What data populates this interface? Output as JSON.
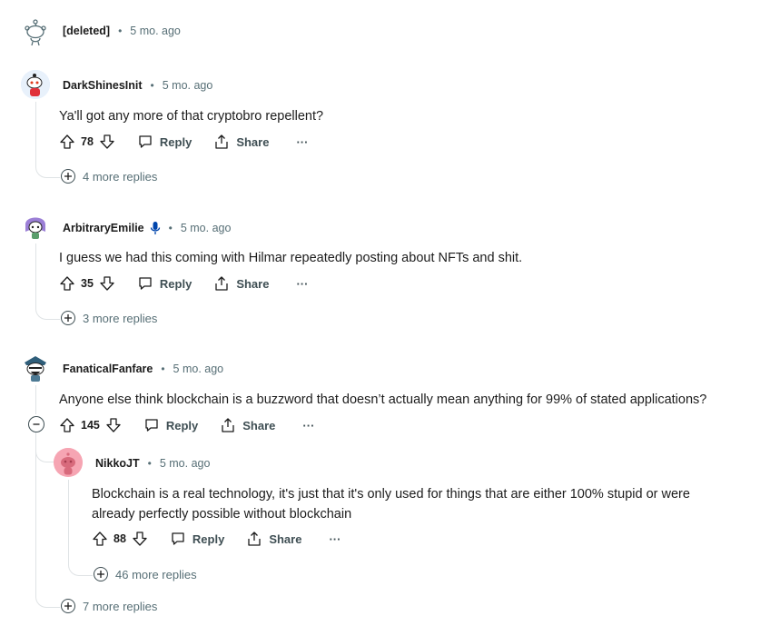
{
  "comments": [
    {
      "username": "[deleted]",
      "time": "5 mo. ago"
    },
    {
      "username": "DarkShinesInit",
      "time": "5 mo. ago",
      "body": "Ya'll got any more of that cryptobro repellent?",
      "votes": "78",
      "reply": "Reply",
      "share": "Share",
      "more_replies": "4 more replies"
    },
    {
      "username": "ArbitraryEmilie",
      "time": "5 mo. ago",
      "body": "I guess we had this coming with Hilmar repeatedly posting about NFTs and shit.",
      "votes": "35",
      "reply": "Reply",
      "share": "Share",
      "more_replies": "3 more replies"
    },
    {
      "username": "FanaticalFanfare",
      "time": "5 mo. ago",
      "body": "Anyone else think blockchain is a buzzword that doesn’t actually mean anything for 99% of stated applications?",
      "votes": "145",
      "reply": "Reply",
      "share": "Share",
      "more_replies": "7 more replies"
    },
    {
      "username": "NikkoJT",
      "time": "5 mo. ago",
      "body_lines": [
        "Blockchain is a real technology, it's just that it's only used for things that are either 100% stupid or were",
        "already perfectly possible without blockchain"
      ],
      "votes": "88",
      "reply": "Reply",
      "share": "Share",
      "more_replies": "46 more replies"
    }
  ],
  "separator": "•",
  "overflow_glyph": "···",
  "colors": {
    "text": "#1c1c1c",
    "meta": "#576f76",
    "thread_line": "#dfe3e5",
    "mic_badge": "#0045ac"
  }
}
